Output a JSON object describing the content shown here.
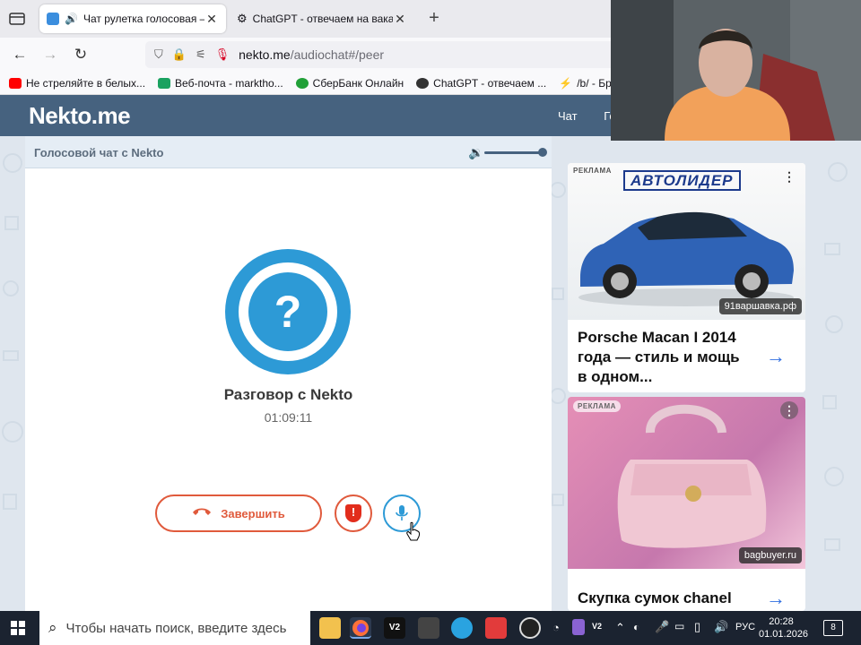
{
  "browser": {
    "tabs": [
      {
        "title": "Чат рулетка голосовая — Н",
        "active": true
      },
      {
        "title": "ChatGPT - отвечаем на ваканс",
        "active": false
      }
    ],
    "url": {
      "host": "nekto.me",
      "path": "/audiochat#/peer"
    },
    "bookmarks": [
      {
        "label": "Не стреляйте в белых...",
        "color": "#ff0000"
      },
      {
        "label": "Веб-почта - markthо...",
        "color": "#1aa260"
      },
      {
        "label": "СберБанк Онлайн",
        "color": "#21a038"
      },
      {
        "label": "ChatGPT - отвечаем ...",
        "color": "#333333"
      },
      {
        "label": "/b/ - Бред",
        "color": "#ff6600"
      }
    ]
  },
  "site": {
    "logo": "Nekto.me",
    "nav": [
      "Чат",
      "Го"
    ]
  },
  "chat": {
    "header_title": "Голосовой чат с Nekto",
    "avatar_symbol": "?",
    "conversation_title": "Разговор с Nekto",
    "timer": "01:09:11",
    "end_button_label": "Завершить",
    "report_symbol": "!"
  },
  "ads": [
    {
      "label": "РЕКЛАМА",
      "brand": "АВТОЛИДЕР",
      "domain": "91варшавка.рф",
      "text": "Porsche Macan I 2014 года — стиль и мощь в одном..."
    },
    {
      "label": "РЕКЛАМА",
      "domain": "bagbuyer.ru",
      "text": "Скупка сумок chanel"
    }
  ],
  "taskbar": {
    "search_placeholder": "Чтобы начать поиск, введите здесь",
    "lang": "РУС",
    "time": "20:28",
    "date": "01.01.2026",
    "notifications": "8"
  },
  "colors": {
    "header": "#46627f",
    "accent_blue": "#2d9ad6",
    "danger": "#e05a3c",
    "link": "#2f6ee0"
  }
}
